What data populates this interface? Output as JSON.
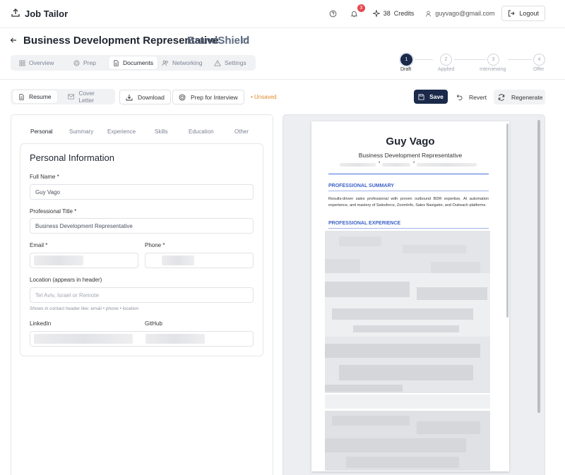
{
  "app": {
    "name": "Job Tailor"
  },
  "header": {
    "notification_count": "3",
    "credits_count": "38",
    "credits_label": "Credits",
    "user_email": "guyvago@gmail.com",
    "logout_label": "Logout"
  },
  "job": {
    "title": "Business Development Representative",
    "company": "BrandShield"
  },
  "tabs": [
    {
      "label": "Overview",
      "icon": "grid-icon"
    },
    {
      "label": "Prep",
      "icon": "target-icon"
    },
    {
      "label": "Documents",
      "icon": "document-icon",
      "active": true
    },
    {
      "label": "Networking",
      "icon": "users-icon"
    },
    {
      "label": "Settings",
      "icon": "warning-icon"
    }
  ],
  "stepper": [
    {
      "number": "1",
      "label": "Draft",
      "active": true
    },
    {
      "number": "2",
      "label": "Applied"
    },
    {
      "number": "3",
      "label": "Interviewing"
    },
    {
      "number": "4",
      "label": "Offer"
    }
  ],
  "toolbar": {
    "resume_label": "Resume",
    "cover_letter_label": "Cover Letter",
    "download_label": "Download",
    "prep_label": "Prep for Interview",
    "unsaved_label": "• Unsaved",
    "save_label": "Save",
    "revert_label": "Revert",
    "regenerate_label": "Regenerate"
  },
  "editor": {
    "subtabs": [
      "Personal",
      "Summary",
      "Experience",
      "Skills",
      "Education",
      "Other"
    ],
    "active_subtab": "Personal",
    "section_title": "Personal Information",
    "fields": {
      "full_name": {
        "label": "Full Name *",
        "value": "Guy Vago"
      },
      "professional_title": {
        "label": "Professional Title *",
        "value": "Business Development Representative"
      },
      "email": {
        "label": "Email *"
      },
      "phone": {
        "label": "Phone *"
      },
      "location": {
        "label": "Location (appears in header)",
        "placeholder": "Tel Aviv, Israel or Remote",
        "hint": "Shows in contact header like: email • phone • location"
      },
      "linkedin": {
        "label": "LinkedIn"
      },
      "github": {
        "label": "GitHub"
      }
    }
  },
  "resume_preview": {
    "name": "Guy Vago",
    "title": "Business Development Representative",
    "contact_separators": [
      "•",
      "•"
    ],
    "sections": [
      {
        "heading": "PROFESSIONAL SUMMARY",
        "text": "Results-driven sales professional with proven outbound BDR expertise, AI automation experience, and mastery of Salesforce, ZoomInfo, Sales Navigator, and Outreach platforms."
      },
      {
        "heading": "PROFESSIONAL EXPERIENCE"
      }
    ]
  },
  "colors": {
    "primary": "#1b2a4a",
    "accent_blue": "#3f63c8",
    "unsaved": "#e08a2a",
    "badge": "#e5484d"
  }
}
